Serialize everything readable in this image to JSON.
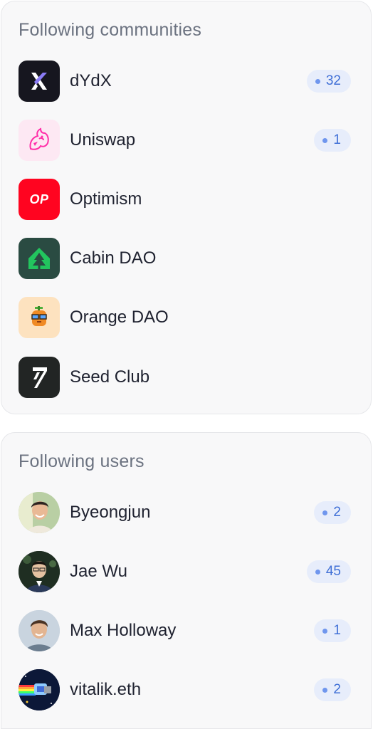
{
  "communities": {
    "title": "Following communities",
    "items": [
      {
        "name": "dYdX",
        "count": "32",
        "icon": "dydx-logo-icon"
      },
      {
        "name": "Uniswap",
        "count": "1",
        "icon": "uniswap-logo-icon"
      },
      {
        "name": "Optimism",
        "icon": "optimism-logo-icon",
        "logo_text": "OP"
      },
      {
        "name": "Cabin DAO",
        "icon": "cabin-dao-logo-icon"
      },
      {
        "name": "Orange DAO",
        "icon": "orange-dao-logo-icon"
      },
      {
        "name": "Seed Club",
        "icon": "seed-club-logo-icon"
      }
    ]
  },
  "users": {
    "title": "Following users",
    "items": [
      {
        "name": "Byeongjun",
        "count": "2",
        "icon": "user-avatar"
      },
      {
        "name": "Jae Wu",
        "count": "45",
        "icon": "user-avatar"
      },
      {
        "name": "Max Holloway",
        "count": "1",
        "icon": "user-avatar"
      },
      {
        "name": "vitalik.eth",
        "count": "2",
        "icon": "user-avatar"
      }
    ]
  },
  "colors": {
    "badge_bg": "#e7edfb",
    "badge_text": "#3f6fd6",
    "badge_dot": "#6f96ee",
    "optimism_red": "#ff0420",
    "cabin_green": "#2a4b42",
    "orange_dao_bg": "#fde2bf"
  }
}
